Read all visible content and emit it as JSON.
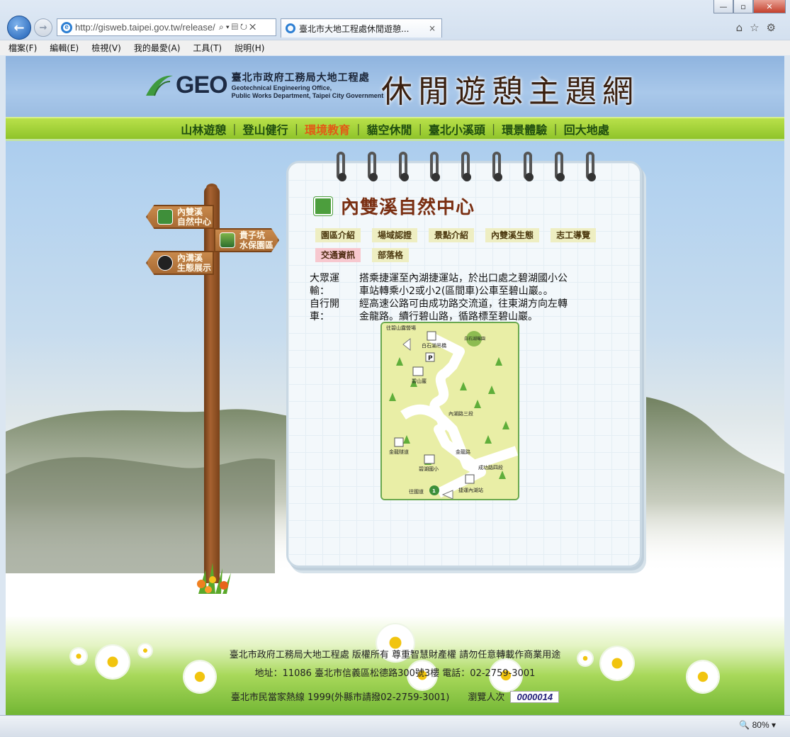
{
  "browser": {
    "url": "http://gisweb.taipei.gov.tw/release/",
    "tab_title": "臺北市大地工程處休閒遊憩...",
    "tab_close": "×",
    "zoom": "80%",
    "menu": [
      "檔案(F)",
      "編輯(E)",
      "檢視(V)",
      "我的最愛(A)",
      "工具(T)",
      "說明(H)"
    ]
  },
  "header": {
    "logo_geo": "GEO",
    "org_zh": "臺北市政府工務局大地工程處",
    "org_en_1": "Geotechnical Engineering Office,",
    "org_en_2": "Public Works Department, Taipei City Government",
    "site_title": "休閒遊憩主題網"
  },
  "nav": {
    "items": [
      "山林遊憩",
      "登山健行",
      "環境教育",
      "貓空休閒",
      "臺北小溪頭",
      "環景體驗",
      "回大地處"
    ],
    "active_index": 2,
    "separator": "|"
  },
  "signs": {
    "neishuangxi_1": "內雙溪",
    "neishuangxi_2": "自然中心",
    "guizikeng_1": "貴子坑",
    "guizikeng_2": "水保園區",
    "neigou_1": "內溝溪",
    "neigou_2": "生態展示"
  },
  "notebook": {
    "title": "內雙溪自然中心",
    "tabs_row1": [
      "園區介紹",
      "場域認證",
      "景點介紹",
      "內雙溪生態",
      "志工導覽"
    ],
    "tabs_row2": [
      "交通資訊",
      "部落格"
    ],
    "active_tab": "交通資訊",
    "transit": [
      {
        "key_1": "大眾運",
        "key_2": "輸：",
        "value_1": "搭乘捷運至內湖捷運站，於出口處之碧湖國小公",
        "value_2": "車站轉乘小2或小2(區間車)公車至碧山巖。。"
      },
      {
        "key_1": "自行開",
        "key_2": "車：",
        "value_1": "經高速公路可由成功路交流道，往東湖方向左轉",
        "value_2": "金龍路。續行碧山路，循路標至碧山巖。"
      }
    ],
    "map_labels": {
      "to_parking": "往碧山露營場",
      "bridge": "白石湖吊橋",
      "farm": "白石湖莓園",
      "parking": "P",
      "temple": "碧山巖",
      "road": "內湖路三段",
      "tunnel": "金龍隧道",
      "school": "碧湖國小",
      "station": "捷運內湖站",
      "jinlong_road": "金龍路",
      "chenggong_road": "成功路四段",
      "to_taipei": "往國道",
      "marker": "1"
    }
  },
  "footer": {
    "line1": "臺北市政府工務局大地工程處 版權所有 尊重智慧財產權 請勿任意轉載作商業用途",
    "line2": "地址：11086 臺北市信義區松德路300號3樓 電話：02-2759-3001",
    "line3": "臺北市民當家熱線 1999(外縣市請撥02-2759-3001)　　瀏覽人次",
    "counter": "0000014"
  }
}
